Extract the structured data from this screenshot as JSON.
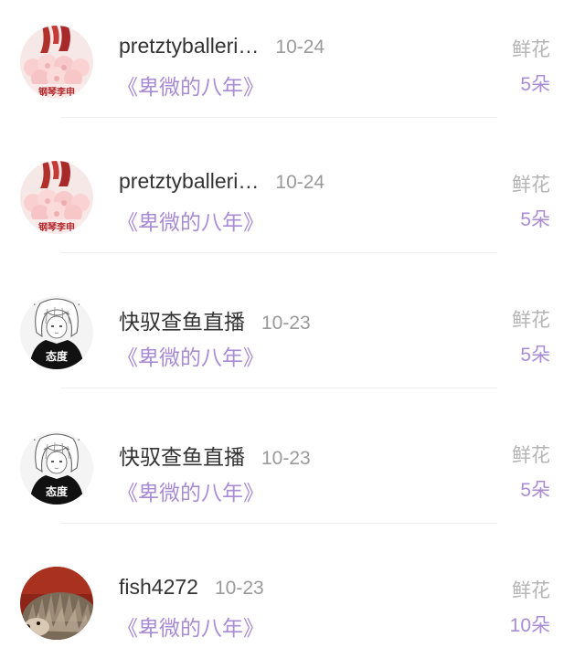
{
  "records": [
    {
      "username": "pretztyballeri…",
      "date": "10-24",
      "book": "《卑微的八年》",
      "gift_label": "鲜花",
      "gift_count": "5朵",
      "avatar_icon": "pink-roses-avatar-icon",
      "avatar_text": "钢琴李申"
    },
    {
      "username": "pretztyballeri…",
      "date": "10-24",
      "book": "《卑微的八年》",
      "gift_label": "鲜花",
      "gift_count": "5朵",
      "avatar_icon": "pink-roses-avatar-icon",
      "avatar_text": "钢琴李申"
    },
    {
      "username": "快驭查鱼直播",
      "date": "10-23",
      "book": "《卑微的八年》",
      "gift_label": "鲜花",
      "gift_count": "5朵",
      "avatar_icon": "anime-girl-avatar-icon",
      "avatar_text": "态度"
    },
    {
      "username": "快驭查鱼直播",
      "date": "10-23",
      "book": "《卑微的八年》",
      "gift_label": "鲜花",
      "gift_count": "5朵",
      "avatar_icon": "anime-girl-avatar-icon",
      "avatar_text": "态度"
    },
    {
      "username": "fish4272",
      "date": "10-23",
      "book": "《卑微的八年》",
      "gift_label": "鲜花",
      "gift_count": "10朵",
      "avatar_icon": "hedgehog-avatar-icon"
    }
  ],
  "colors": {
    "accent_purple": "#a98bd6",
    "username": "#333333",
    "muted": "#9a9a9a",
    "gift_label": "#b4b4b4"
  }
}
